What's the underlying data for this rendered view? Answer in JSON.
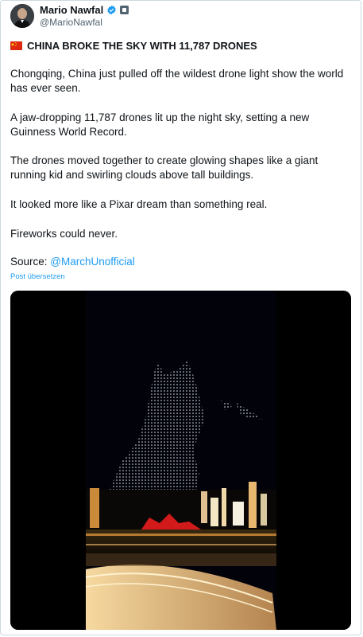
{
  "author": {
    "display_name": "Mario Nawfal",
    "handle": "@MarioNawfal",
    "verified_icon": "verified-badge-icon",
    "affiliation_icon": "affiliation-badge-icon"
  },
  "post": {
    "headline": "CHINA BROKE THE SKY WITH 11,787 DRONES",
    "flag_icon": "china-flag-icon",
    "paragraphs": [
      "Chongqing, China just pulled off the wildest drone light show the world has ever seen.",
      "A jaw-dropping 11,787 drones lit up the night sky, setting a new Guinness World Record.",
      "The drones moved together to create glowing shapes like a giant running kid and swirling clouds above tall buildings.",
      "It looked more like a Pixar dream than something real.",
      "Fireworks could never."
    ],
    "source_label": "Source: ",
    "source_link": "@MarchUnofficial",
    "translate_label": "Post übersetzen"
  },
  "colors": {
    "link": "#1d9bf0",
    "text": "#0f1419",
    "muted": "#536471",
    "verified": "#1d9bf0"
  }
}
